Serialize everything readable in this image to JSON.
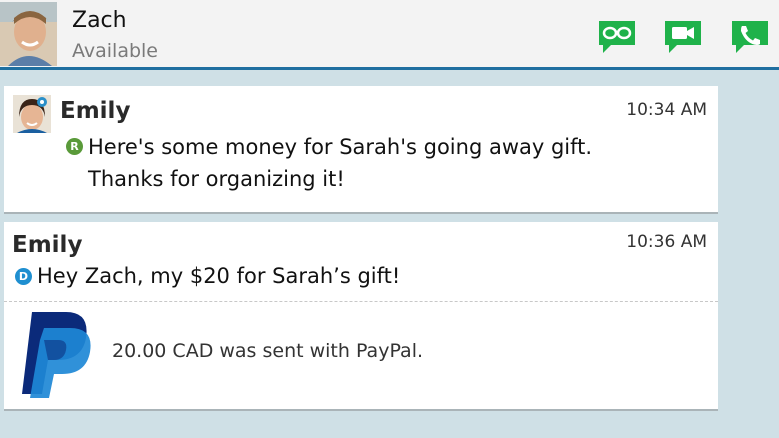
{
  "header": {
    "contact_name": "Zach",
    "contact_status": "Available",
    "actions": [
      "glasses-icon",
      "video-call-icon",
      "phone-icon"
    ],
    "action_color": "#1fb24a"
  },
  "messages": [
    {
      "sender": "Emily",
      "time": "10:34 AM",
      "status_letter": "R",
      "status_color": "#5a9a3a",
      "line1": "Here's some money for Sarah's going away gift.",
      "line2": "Thanks for organizing it!"
    },
    {
      "sender": "Emily",
      "time": "10:36 AM",
      "status_letter": "D",
      "status_color": "#1f8fd0",
      "text": "Hey Zach, my $20 for Sarah’s gift!",
      "attachment": {
        "icon": "paypal-icon",
        "text": "20.00 CAD was sent with PayPal."
      }
    }
  ],
  "colors": {
    "background": "#cfe0e6",
    "header_border": "#1f6fa0",
    "paypal_dark": "#0b2a7a",
    "paypal_light": "#1e88d6"
  }
}
